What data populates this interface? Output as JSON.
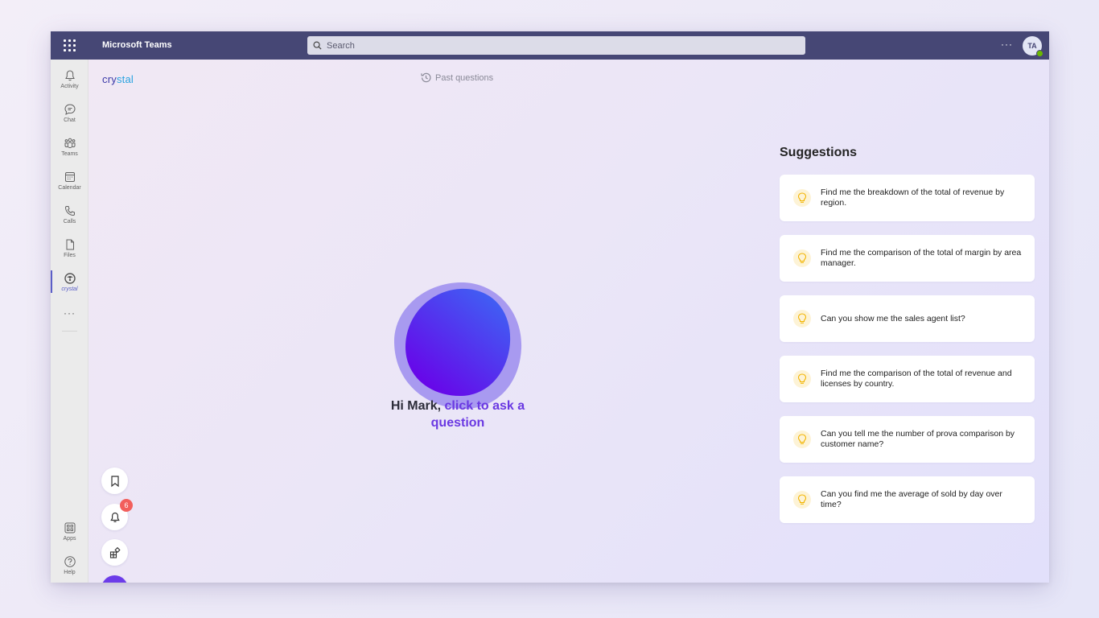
{
  "app": {
    "title": "Microsoft Teams"
  },
  "search": {
    "placeholder": "Search"
  },
  "topbar": {
    "more": "···",
    "avatar_initials": "TA"
  },
  "rail": {
    "items": [
      {
        "label": "Activity",
        "icon": "bell-icon"
      },
      {
        "label": "Chat",
        "icon": "chat-icon"
      },
      {
        "label": "Teams",
        "icon": "teams-icon"
      },
      {
        "label": "Calendar",
        "icon": "calendar-icon"
      },
      {
        "label": "Calls",
        "icon": "phone-icon"
      },
      {
        "label": "Files",
        "icon": "file-icon"
      },
      {
        "label": "crystal",
        "icon": "crystal-icon",
        "active": true
      }
    ],
    "more": "···",
    "bottom_items": [
      {
        "label": "Apps",
        "icon": "apps-icon"
      },
      {
        "label": "Help",
        "icon": "help-icon"
      }
    ]
  },
  "brand": {
    "name_prefix": "cry",
    "name_suffix": "stal"
  },
  "header": {
    "past_questions": "Past questions"
  },
  "greeting": {
    "hi": "Hi Mark",
    "comma": ",",
    "cta": "click to ask a question"
  },
  "suggestions": {
    "title": "Suggestions",
    "items": [
      "Find me the breakdown of the total of revenue by region.",
      "Find me the comparison of the total of margin by area manager.",
      "Can you show me the sales agent list?",
      "Find me the comparison of the total of revenue and licenses by country.",
      "Can you tell me the number of prova comparison by customer name?",
      "Can you find me the average of sold by day over time?"
    ]
  },
  "floating": {
    "notifications_count": "6"
  },
  "colors": {
    "accent": "#6a39e2",
    "topbar": "#464775",
    "orb_start": "#3a6cf5",
    "orb_end": "#6a00e8"
  }
}
